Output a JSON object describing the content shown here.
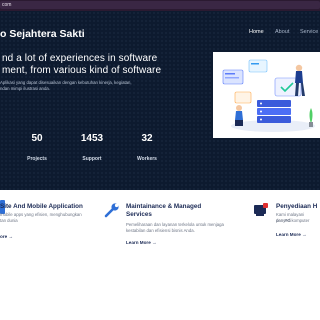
{
  "browser": {
    "url": "com"
  },
  "header": {
    "brand": "o Sejahtera Sakti",
    "nav": [
      {
        "label": "Home",
        "active": true
      },
      {
        "label": "About",
        "active": false
      },
      {
        "label": "Service",
        "active": false
      }
    ]
  },
  "hero": {
    "headline_line1": "nd a lot of experiences in software",
    "headline_line2": "ment, from various kind of software",
    "sub_line1": "Aplikasi yang dapat disesuaikan dengan kebutuhan kinerja, kegiatan,",
    "sub_line2": "ndan mimpi ilustrasi anda."
  },
  "stats": [
    {
      "value": "50",
      "label": "Projects"
    },
    {
      "value": "1453",
      "label": "Support"
    },
    {
      "value": "32",
      "label": "Workers"
    }
  ],
  "services": [
    {
      "title_line1": "Site And Mobile Application",
      "title_line2": "",
      "text_line1": "mobile apps yang efisien, menghubungkan",
      "text_line2": "tan dunia",
      "more": "ore",
      "icon": "mobile-web-icon"
    },
    {
      "title_line1": "Maintainance & Managed",
      "title_line2": "Services",
      "text_line1": "Pemeliharaan dan layanan terkelola untuk menjaga",
      "text_line2": "kestabilan dan efisiensi bisnis Anda.",
      "more": "Learn More",
      "icon": "wrench-icon"
    },
    {
      "title_line1": "Penyediaan H",
      "title_line2": "",
      "text_line1": "Kami malayani penyedi",
      "text_line2": "dan PC komputer",
      "more": "Learn More",
      "icon": "hardware-icon"
    }
  ],
  "colors": {
    "hero_bg": "#0d1a2f",
    "navy": "#1b2a55",
    "accent": "#2f6fd6"
  }
}
